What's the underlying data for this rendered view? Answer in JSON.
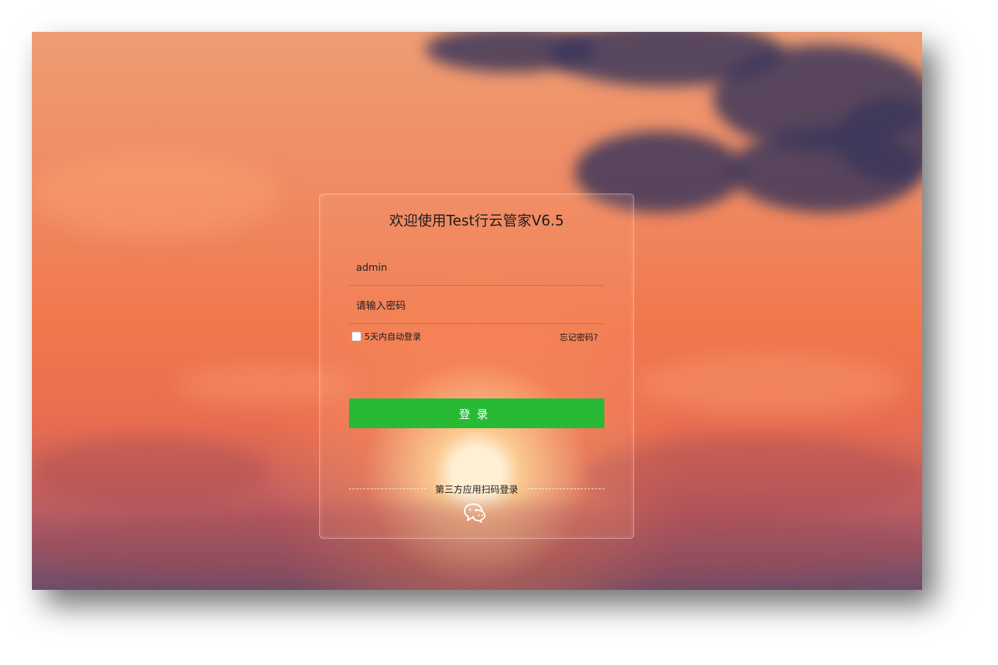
{
  "login": {
    "title": "欢迎使用Test行云管家V6.5",
    "username_value": "admin",
    "password_placeholder": "请输入密码",
    "remember_label": "5天内自动登录",
    "forgot_label": "忘记密码?",
    "submit_label": "登录",
    "third_party_label": "第三方应用扫码登录",
    "third_party_icon": "wechat-icon"
  },
  "colors": {
    "primary_button": "#28b935",
    "input_border": "#6f8aa2"
  }
}
